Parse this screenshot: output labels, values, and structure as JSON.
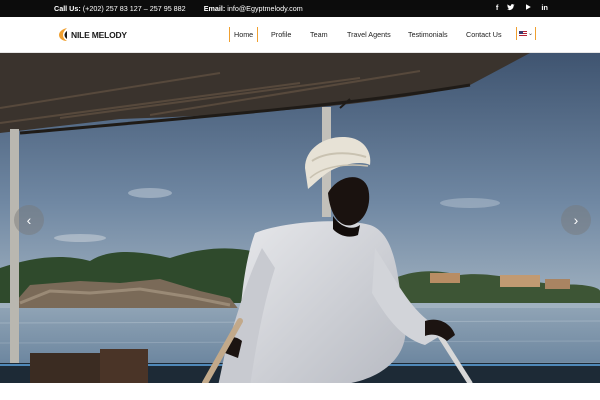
{
  "topbar": {
    "call_label": "Call Us:",
    "call_value": "(+202) 257 83 127 – 257 95 882",
    "email_label": "Email:",
    "email_value": "info@Egyptmelody.com",
    "social": [
      {
        "icon": "facebook-icon",
        "glyph": "f"
      },
      {
        "icon": "twitter-icon",
        "glyph": "t"
      },
      {
        "icon": "youtube-icon",
        "glyph": "▶"
      },
      {
        "icon": "linkedin-icon",
        "glyph": "in"
      }
    ]
  },
  "header": {
    "logo_text": "NILE MELODY",
    "nav": [
      "Home",
      "Profile",
      "Team",
      "Travel Agents",
      "Testimonials",
      "Contact Us"
    ],
    "active_nav": "Home",
    "language": {
      "icon": "us-flag-icon",
      "chevron": "chevron-down-icon"
    }
  },
  "hero": {
    "prev_icon": "chevron-left-icon",
    "next_icon": "chevron-right-icon",
    "prev_glyph": "‹",
    "next_glyph": "›"
  },
  "colors": {
    "topbar_bg": "#0c0c0c",
    "accent": "#f0a030",
    "sky_top": "#4b5f7c",
    "water": "#6f8ca6"
  }
}
